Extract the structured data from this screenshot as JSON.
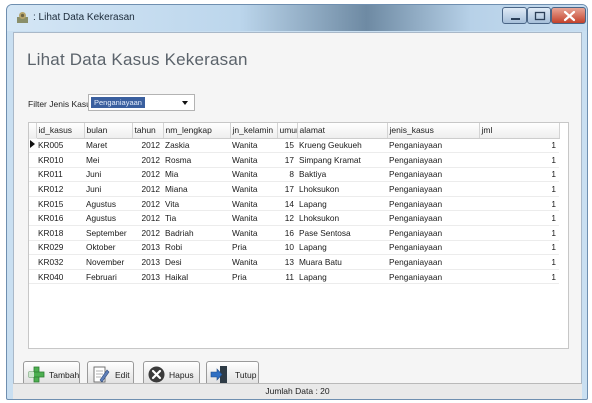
{
  "window": {
    "title": ": Lihat Data Kekerasan"
  },
  "heading": "Lihat Data Kasus Kekerasan",
  "filter": {
    "label": "Filter Jenis Kasus",
    "selected": "Penganiayaan"
  },
  "table": {
    "columns": [
      "id_kasus",
      "bulan",
      "tahun",
      "nm_lengkap",
      "jn_kelamin",
      "umur",
      "alamat",
      "jenis_kasus",
      "jml"
    ],
    "rows": [
      [
        "KR005",
        "Maret",
        "2012",
        "Zaskia",
        "Wanita",
        "15",
        "Krueng Geukueh",
        "Penganiayaan",
        "1"
      ],
      [
        "KR010",
        "Mei",
        "2012",
        "Rosma",
        "Wanita",
        "17",
        "Simpang Kramat",
        "Penganiayaan",
        "1"
      ],
      [
        "KR011",
        "Juni",
        "2012",
        "Mia",
        "Wanita",
        "8",
        "Baktiya",
        "Penganiayaan",
        "1"
      ],
      [
        "KR012",
        "Juni",
        "2012",
        "Miana",
        "Wanita",
        "17",
        "Lhoksukon",
        "Penganiayaan",
        "1"
      ],
      [
        "KR015",
        "Agustus",
        "2012",
        "Vita",
        "Wanita",
        "14",
        "Lapang",
        "Penganiayaan",
        "1"
      ],
      [
        "KR016",
        "Agustus",
        "2012",
        "Tia",
        "Wanita",
        "12",
        "Lhoksukon",
        "Penganiayaan",
        "1"
      ],
      [
        "KR018",
        "September",
        "2012",
        "Badriah",
        "Wanita",
        "16",
        "Pase Sentosa",
        "Penganiayaan",
        "1"
      ],
      [
        "KR029",
        "Oktober",
        "2013",
        "Robi",
        "Pria",
        "10",
        "Lapang",
        "Penganiayaan",
        "1"
      ],
      [
        "KR032",
        "November",
        "2013",
        "Desi",
        "Wanita",
        "13",
        "Muara Batu",
        "Penganiayaan",
        "1"
      ],
      [
        "KR040",
        "Februari",
        "2013",
        "Haikal",
        "Pria",
        "11",
        "Lapang",
        "Penganiayaan",
        "1"
      ]
    ]
  },
  "buttons": {
    "tambah": "Tambah",
    "edit": "Edit",
    "hapus": "Hapus",
    "tutup": "Tutup"
  },
  "status": "Jumlah Data : 20",
  "icons": {
    "app": "app-icon",
    "minimize": "minimize-icon",
    "maximize": "maximize-icon",
    "close": "close-icon",
    "tambah": "add-icon",
    "edit": "edit-icon",
    "hapus": "delete-icon",
    "tutup": "exit-icon"
  },
  "colors": {
    "selection": "#3a5f9e",
    "close": "#c3412a",
    "add": "#4caf50"
  }
}
